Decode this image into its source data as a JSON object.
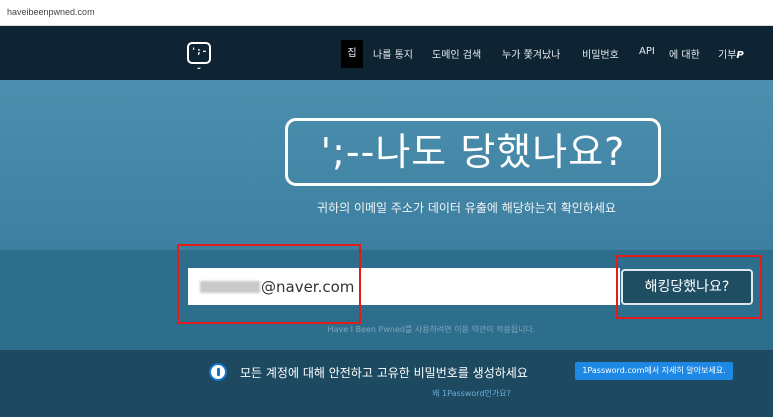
{
  "browser": {
    "url": "haveibeenpwned.com"
  },
  "nav": {
    "logo_text": "';--",
    "items": [
      {
        "label": "집"
      },
      {
        "label": "나를 통지"
      },
      {
        "label": "도메인 검색"
      },
      {
        "label": "누가 쫓겨났나"
      },
      {
        "label": "비밀번호"
      },
      {
        "label": "API"
      },
      {
        "label": "에 대한"
      },
      {
        "label": "기부"
      }
    ],
    "donate_icon": "paypal-icon"
  },
  "hero": {
    "title": "';--나도 당했나요?",
    "subtitle": "귀하의 이메일 주소가 데이터 유출에 해당하는지 확인하세요"
  },
  "search": {
    "email_visible": "@naver.com",
    "button_label": "해킹당했나요?",
    "terms": "Have I Been Pwned를 사용하려면 이용 약관이 적용됩니다."
  },
  "promo": {
    "text": "모든 계정에 대해 안전하고 고유한 비밀번호를 생성하세요",
    "button_label": "1Password.com에서 자세히 알아보세요.",
    "link": "왜 1Password인가요?"
  },
  "colors": {
    "nav_bg": "#0e2433",
    "hero_bg": "#4d8fae",
    "search_band_bg": "#2d6e8d",
    "promo_bg": "#1d4a60",
    "button_bg": "#1f4e63",
    "annotation_red": "#e41b1b",
    "promo_button": "#1e88e5"
  }
}
